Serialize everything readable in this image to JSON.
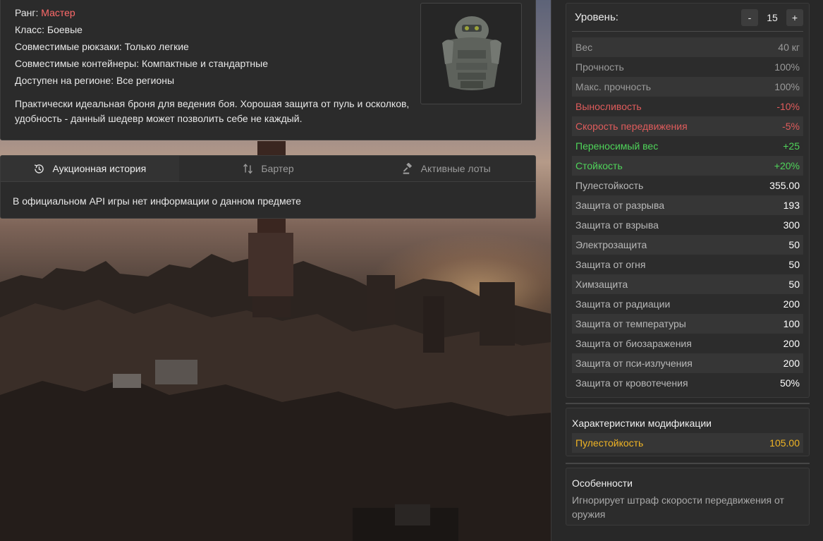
{
  "item": {
    "rank_label": "Ранг:",
    "rank_value": "Мастер",
    "class_text": "Класс: Боевые",
    "backpacks_text": "Совместимые рюкзаки: Только легкие",
    "containers_text": "Совместимые контейнеры: Компактные и стандартные",
    "region_text": "Доступен на регионе: Все регионы",
    "description": "Практически идеальная броня для ведения боя. Хорошая защита от пуль и осколков, удобность - данный шедевр может позволить себе не каждый."
  },
  "tabs": [
    {
      "label": "Аукционная история",
      "icon": "history-icon",
      "active": true
    },
    {
      "label": "Бартер",
      "icon": "swap-arrows-icon",
      "active": false
    },
    {
      "label": "Активные лоты",
      "icon": "gavel-icon",
      "active": false
    }
  ],
  "tab_content": "В официальном API игры нет информации о данном предмете",
  "level": {
    "label": "Уровень:",
    "minus": "-",
    "value": "15",
    "plus": "+"
  },
  "stats": [
    {
      "name": "Вес",
      "value": "40 кг",
      "tone": "gray"
    },
    {
      "name": "Прочность",
      "value": "100%",
      "tone": "gray"
    },
    {
      "name": "Макс. прочность",
      "value": "100%",
      "tone": "gray"
    },
    {
      "name": "Выносливость",
      "value": "-10%",
      "tone": "red"
    },
    {
      "name": "Скорость передвижения",
      "value": "-5%",
      "tone": "red"
    },
    {
      "name": "Переносимый вес",
      "value": "+25",
      "tone": "green"
    },
    {
      "name": "Стойкость",
      "value": "+20%",
      "tone": "green"
    },
    {
      "name": "Пулестойкость",
      "value": "355.00",
      "tone": "white"
    },
    {
      "name": "Защита от разрыва",
      "value": "193",
      "tone": "white"
    },
    {
      "name": "Защита от взрыва",
      "value": "300",
      "tone": "white"
    },
    {
      "name": "Электрозащита",
      "value": "50",
      "tone": "white"
    },
    {
      "name": "Защита от огня",
      "value": "50",
      "tone": "white"
    },
    {
      "name": "Химзащита",
      "value": "50",
      "tone": "white"
    },
    {
      "name": "Защита от радиации",
      "value": "200",
      "tone": "white"
    },
    {
      "name": "Защита от температуры",
      "value": "100",
      "tone": "white"
    },
    {
      "name": "Защита от биозаражения",
      "value": "200",
      "tone": "white"
    },
    {
      "name": "Защита от пси-излучения",
      "value": "200",
      "tone": "white"
    },
    {
      "name": "Защита от кровотечения",
      "value": "50%",
      "tone": "white"
    }
  ],
  "modification": {
    "title": "Характеристики модификации",
    "stat_name": "Пулестойкость",
    "stat_value": "105.00"
  },
  "features": {
    "title": "Особенности",
    "text": "Игнорирует штраф скорости передвижения от оружия"
  },
  "colors": {
    "rank": "#ff6a6a",
    "negative": "#e05c5c",
    "positive": "#4fd45a",
    "modification": "#f0b424"
  }
}
